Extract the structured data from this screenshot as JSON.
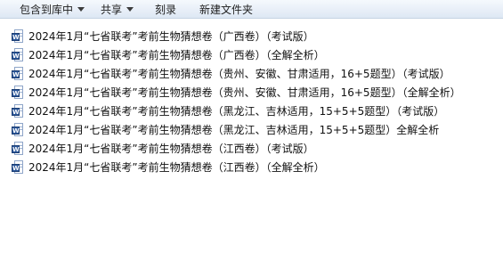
{
  "toolbar": {
    "items": [
      {
        "label": "包含到库中",
        "has_dropdown": true
      },
      {
        "label": "共享",
        "has_dropdown": true
      },
      {
        "label": "刻录",
        "has_dropdown": false
      },
      {
        "label": "新建文件夹",
        "has_dropdown": false
      }
    ]
  },
  "files": [
    {
      "icon": "word-document-icon",
      "name": "2024年1月“七省联考”考前生物猜想卷（广西卷）（考试版）"
    },
    {
      "icon": "word-document-icon",
      "name": "2024年1月“七省联考”考前生物猜想卷（广西卷）（全解全析）"
    },
    {
      "icon": "word-document-icon",
      "name": "2024年1月“七省联考”考前生物猜想卷（贵州、安徽、甘肃适用，16+5题型）（考试版）"
    },
    {
      "icon": "word-document-icon",
      "name": "2024年1月“七省联考”考前生物猜想卷（贵州、安徽、甘肃适用，16+5题型）（全解全析）"
    },
    {
      "icon": "word-document-icon",
      "name": "2024年1月“七省联考”考前生物猜想卷（黑龙江、吉林适用，15+5+5题型）（考试版）"
    },
    {
      "icon": "word-document-icon",
      "name": "2024年1月“七省联考”考前生物猜想卷（黑龙江、吉林适用，15+5+5题型）全解全析"
    },
    {
      "icon": "word-document-icon",
      "name": "2024年1月“七省联考”考前生物猜想卷（江西卷）（考试版）"
    },
    {
      "icon": "word-document-icon",
      "name": "2024年1月“七省联考”考前生物猜想卷（江西卷）（全解全析）"
    }
  ],
  "icon_badge_letter": "W",
  "colors": {
    "toolbar_bg": "#e8eff8",
    "word_blue": "#2a5699",
    "text": "#111111"
  }
}
